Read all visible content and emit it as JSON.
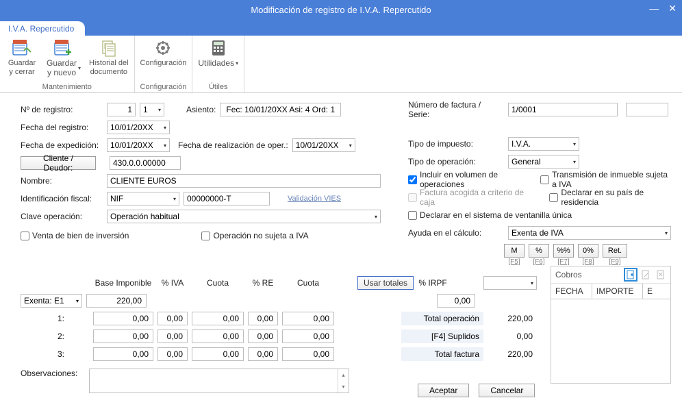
{
  "window": {
    "title": "Modificación de registro de I.V.A. Repercutido"
  },
  "tab": {
    "label": "I.V.A. Repercutido"
  },
  "ribbon": {
    "mantenimiento": {
      "label": "Mantenimiento",
      "guardar_cerrar": "Guardar\ny cerrar",
      "guardar_nuevo": "Guardar\ny nuevo",
      "historial": "Historial del\ndocumento"
    },
    "configuracion": {
      "label": "Configuración",
      "config": "Configuración"
    },
    "utiles": {
      "label": "Útiles",
      "utilidades": "Utilidades"
    }
  },
  "form": {
    "n_registro_label": "Nº de registro:",
    "n_registro_a": "1",
    "n_registro_b": "1",
    "asiento_label": "Asiento:",
    "asiento_value": "Fec: 10/01/20XX Asi: 4 Ord: 1",
    "fecha_registro_label": "Fecha del registro:",
    "fecha_registro": "10/01/20XX",
    "fecha_exped_label": "Fecha de expedición:",
    "fecha_exped": "10/01/20XX",
    "fecha_oper_label": "Fecha de realización de oper.:",
    "fecha_oper": "10/01/20XX",
    "cliente_btn": "Cliente / Deudor:",
    "cliente_code": "430.0.0.00000",
    "nombre_label": "Nombre:",
    "nombre": "CLIENTE EUROS",
    "ident_label": "Identificación fiscal:",
    "ident_tipo": "NIF",
    "ident_num": "00000000-T",
    "vies": "Validación VIES",
    "clave_label": "Clave operación:",
    "clave": "Operación habitual",
    "chk_venta": "Venta de bien de inversión",
    "chk_no_sujeta": "Operación no sujeta a IVA",
    "num_factura_label": "Número de factura / Serie:",
    "num_factura": "1/0001",
    "tipo_impuesto_label": "Tipo de impuesto:",
    "tipo_impuesto": "I.V.A.",
    "tipo_oper_label": "Tipo de operación:",
    "tipo_oper": "General",
    "chk_volumen": "Incluir en volumen de operaciones",
    "chk_transmision": "Transmisión de inmueble sujeta a IVA",
    "chk_caja": "Factura acogida a criterio de caja",
    "chk_residencia": "Declarar en su país de residencia",
    "chk_ventanilla": "Declarar en el sistema de ventanilla única",
    "ayuda_label": "Ayuda en el cálculo:",
    "ayuda": "Exenta de IVA",
    "calc": {
      "m": "M",
      "pct": "%",
      "pctpct": "%%",
      "zpct": "0%",
      "ret": "Ret.",
      "f5": "[F5]",
      "f6": "[F6]",
      "f7": "[F7]",
      "f8": "[F8]",
      "f9": "[F9]"
    }
  },
  "grid": {
    "headers": {
      "base": "Base Imponible",
      "iva": "% IVA",
      "cuota1": "Cuota",
      "re": "% RE",
      "cuota2": "Cuota",
      "usar": "Usar totales",
      "irpf": "% IRPF"
    },
    "exenta_label": "Exenta: E1",
    "rows": {
      "exenta": {
        "base": "220,00"
      },
      "r1": {
        "label": "1:",
        "base": "0,00",
        "iva": "0,00",
        "cuota1": "0,00",
        "re": "0,00",
        "cuota2": "0,00"
      },
      "r2": {
        "label": "2:",
        "base": "0,00",
        "iva": "0,00",
        "cuota1": "0,00",
        "re": "0,00",
        "cuota2": "0,00"
      },
      "r3": {
        "label": "3:",
        "base": "0,00",
        "iva": "0,00",
        "cuota1": "0,00",
        "re": "0,00",
        "cuota2": "0,00"
      }
    },
    "right": {
      "irpf_val": "0,00",
      "total_op_label": "Total operación",
      "total_op": "220,00",
      "suplidos_label": "[F4] Suplidos",
      "suplidos": "0,00",
      "total_factura_label": "Total factura",
      "total_factura": "220,00"
    },
    "obs_label": "Observaciones:"
  },
  "cobros": {
    "title": "Cobros",
    "headers": {
      "fecha": "FECHA",
      "importe": "IMPORTE",
      "e": "E"
    }
  },
  "bottom": {
    "aceptar": "Aceptar",
    "cancelar": "Cancelar"
  }
}
